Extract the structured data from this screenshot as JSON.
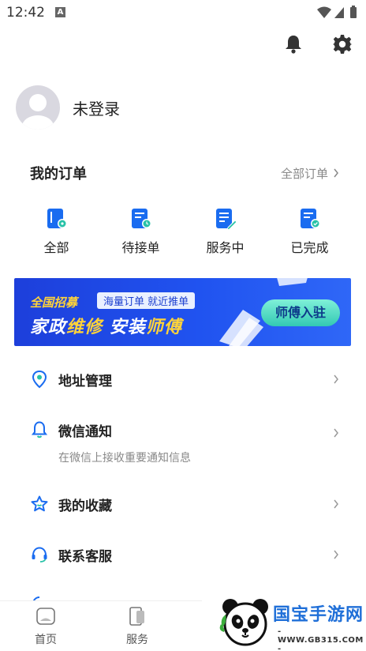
{
  "status": {
    "time": "12:42",
    "notification_letter": "A"
  },
  "header": {
    "bell_icon": "bell-icon",
    "settings_icon": "gear-icon"
  },
  "profile": {
    "name": "未登录"
  },
  "orders": {
    "title": "我的订单",
    "view_all": "全部订单",
    "items": [
      {
        "label": "全部",
        "icon": "order-all-icon"
      },
      {
        "label": "待接单",
        "icon": "order-pending-icon"
      },
      {
        "label": "服务中",
        "icon": "order-in-service-icon"
      },
      {
        "label": "已完成",
        "icon": "order-completed-icon"
      }
    ]
  },
  "banner": {
    "tag": "全国招募",
    "pill": "海量订单 就近推单",
    "line_a": "家政",
    "line_b": "维修",
    "line_c": " 安装",
    "line_d": "师傅",
    "button": "师傅入驻"
  },
  "menu": {
    "address": {
      "label": "地址管理"
    },
    "wechat": {
      "label": "微信通知",
      "sub": "在微信上接收重要通知信息"
    },
    "favorites": {
      "label": "我的收藏"
    },
    "service": {
      "label": "联系客服"
    }
  },
  "bottom_nav": {
    "home": "首页",
    "service": "服务"
  },
  "watermark": {
    "name": "国宝手游网",
    "url": "- WWW.GB315.COM -"
  },
  "colors": {
    "accent": "#1a6cf0",
    "text": "#222222",
    "muted": "#888888"
  }
}
